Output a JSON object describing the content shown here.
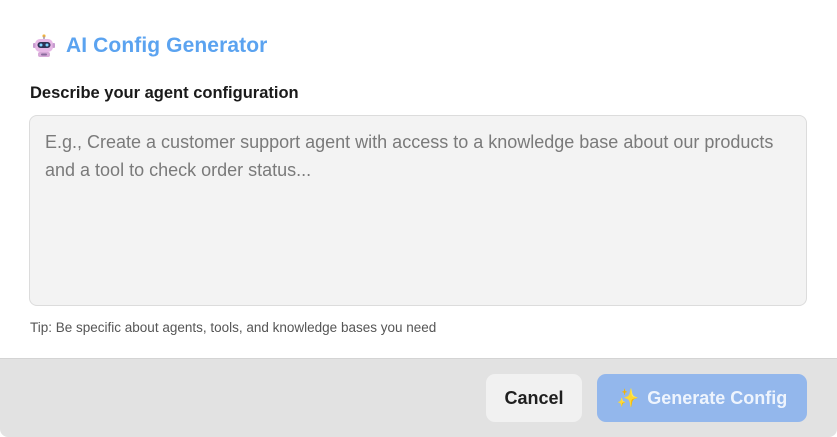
{
  "dialog": {
    "title": "AI Config Generator",
    "title_icon": "robot-icon",
    "field_label": "Describe your agent configuration",
    "textarea": {
      "value": "",
      "placeholder": "E.g., Create a customer support agent with access to a knowledge base about our products and a tool to check order status..."
    },
    "tip": "Tip: Be specific about agents, tools, and knowledge bases you need"
  },
  "footer": {
    "cancel_label": "Cancel",
    "generate_label": "Generate Config",
    "generate_icon": "sparkles-icon",
    "generate_disabled": true
  },
  "colors": {
    "accent": "#5ba3f0",
    "generate_button": "#93b7ec",
    "footer_bg": "#e2e2e2"
  }
}
